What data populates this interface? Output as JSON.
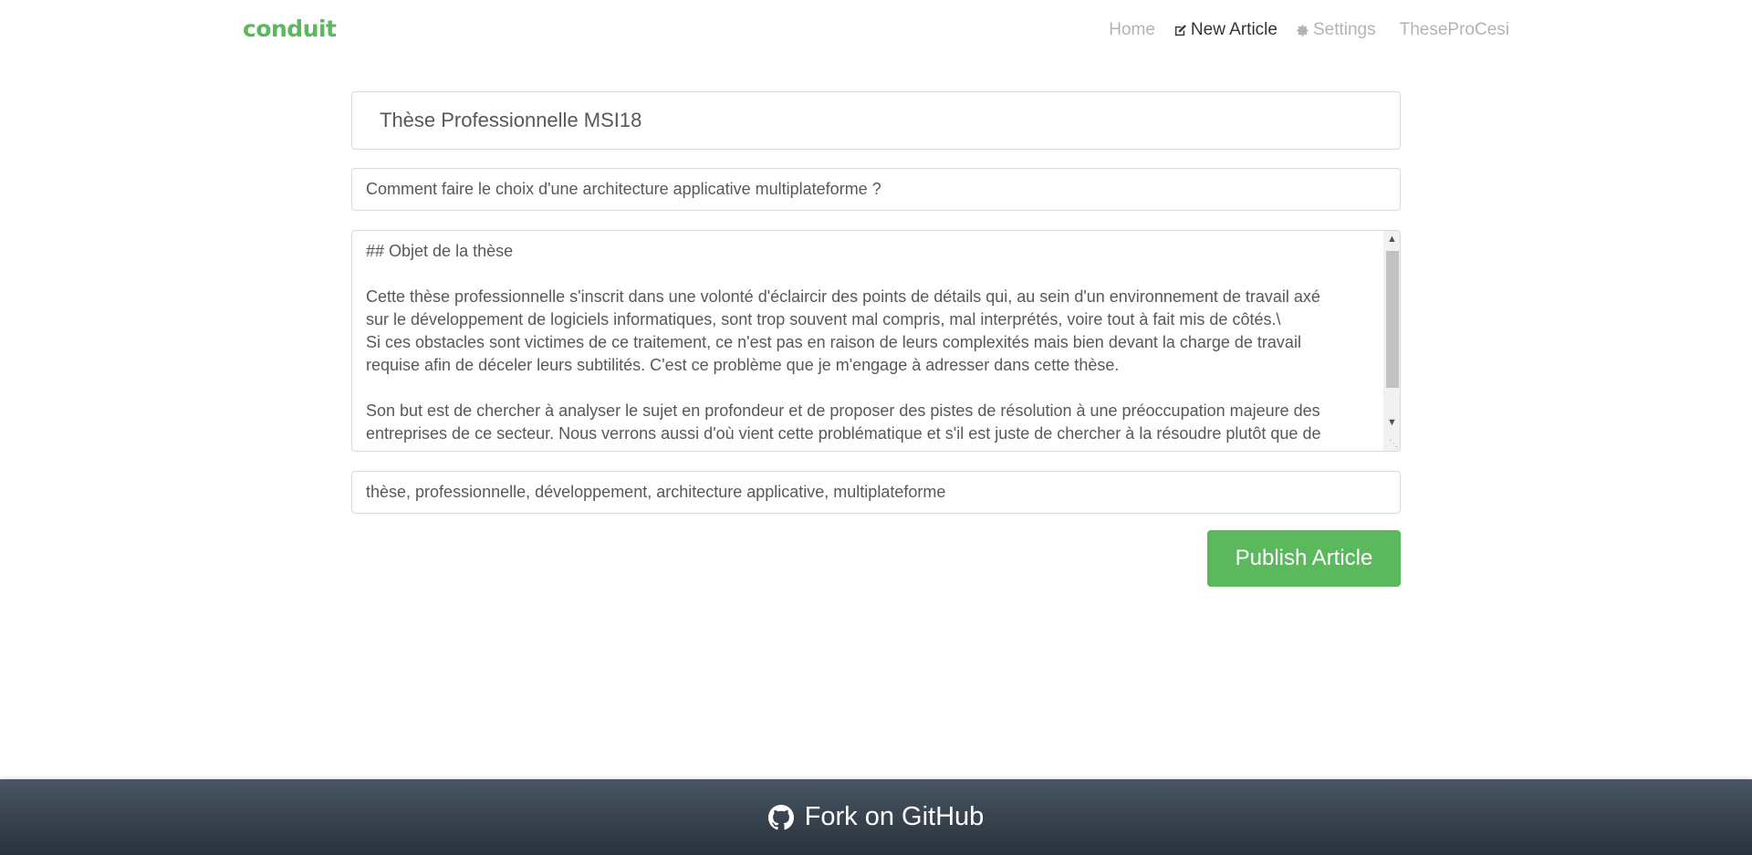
{
  "nav": {
    "brand": "conduit",
    "home": "Home",
    "new_article": "New Article",
    "settings": "Settings",
    "username": "TheseProCesi",
    "icons": {
      "new_article": "edit-icon",
      "settings": "gear-icon"
    }
  },
  "editor": {
    "title": "Thèse Professionnelle MSI18",
    "description": "Comment faire le choix d'une architecture applicative multiplateforme ?",
    "body_lines": [
      "## Objet de la thèse",
      "",
      "Cette thèse professionnelle s'inscrit dans une volonté d'éclaircir des points de détails qui, au sein d'un environnement de travail axé",
      "sur le développement de logiciels informatiques, sont trop souvent mal compris, mal interprétés, voire tout à fait mis de côtés.\\",
      "Si ces obstacles sont victimes de ce traitement, ce n'est pas en raison de leurs complexités mais bien devant la charge de travail",
      "requise afin de déceler leurs subtilités. C'est ce problème que je m'engage à adresser dans cette thèse.",
      "",
      "Son but est de chercher à analyser le sujet en profondeur et de proposer des pistes de résolution à une préoccupation majeure des",
      "entreprises de ce secteur. Nous verrons aussi d'où vient cette problématique et s'il est juste de chercher à la résoudre plutôt que de"
    ],
    "tags": "thèse, professionnelle, développement, architecture applicative, multiplateforme",
    "publish_label": "Publish Article"
  },
  "footer": {
    "link_label": "Fork on GitHub",
    "icon": "github-icon"
  },
  "colors": {
    "brand": "#5cb85c",
    "footer_gradient_top": "#485563",
    "footer_gradient_bottom": "#29323c"
  }
}
